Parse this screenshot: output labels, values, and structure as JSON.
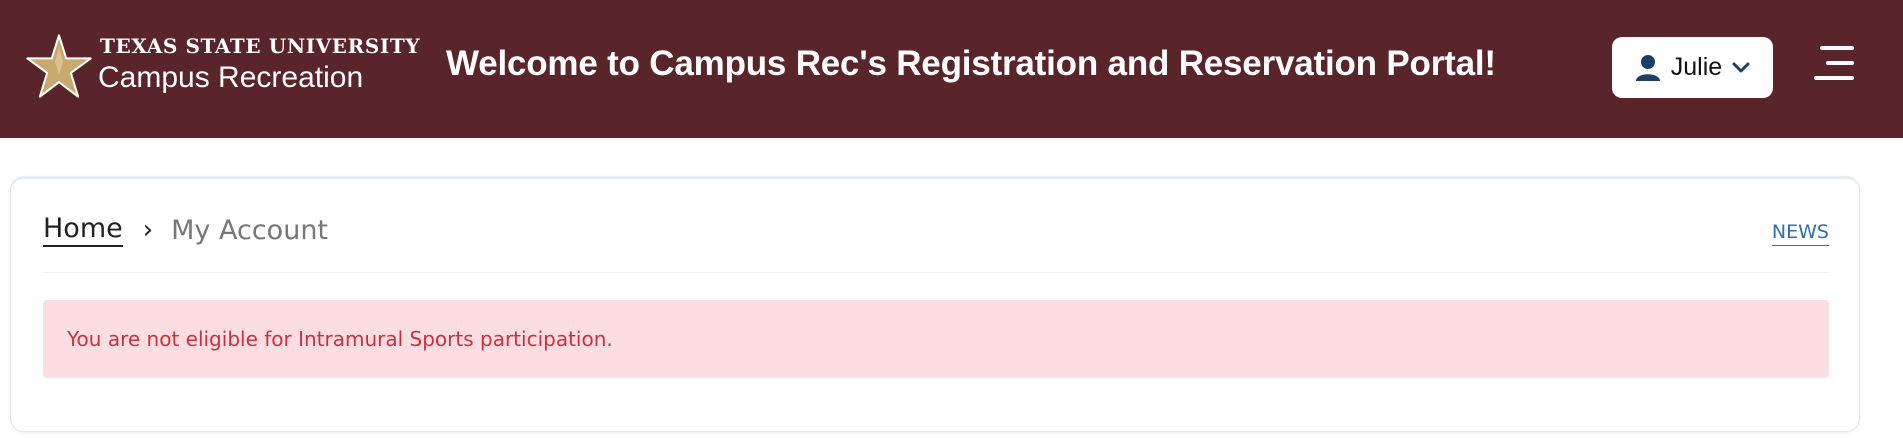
{
  "header": {
    "logo": {
      "university": "TEXAS STATE UNIVERSITY",
      "department": "Campus Recreation"
    },
    "welcome": "Welcome to Campus Rec's Registration and Reservation Portal!",
    "user_menu": {
      "name": "Julie",
      "icon": "user-icon",
      "caret": "chevron-down-icon"
    },
    "menu_icon": "hamburger-icon"
  },
  "breadcrumb": {
    "items": [
      {
        "label": "Home"
      },
      {
        "label": "My Account"
      }
    ]
  },
  "news_link": "NEWS",
  "alert": {
    "message": "You are not eligible for Intramural Sports participation."
  },
  "colors": {
    "header_bg": "#5a242b",
    "logo_gold": "#c8a96e",
    "alert_bg": "#fcdde1",
    "alert_text": "#c8323f",
    "link_blue": "#2f6fb0"
  }
}
